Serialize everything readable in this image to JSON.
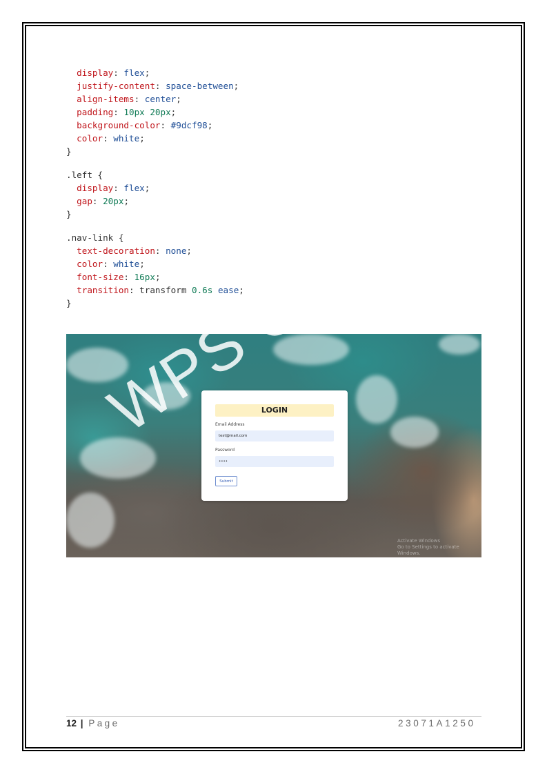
{
  "code": {
    "lines": [
      {
        "indent": "  ",
        "prop": "display",
        "value": "flex",
        "value_kind": "val"
      },
      {
        "indent": "  ",
        "prop": "justify-content",
        "value": "space-between",
        "value_kind": "val"
      },
      {
        "indent": "  ",
        "prop": "align-items",
        "value": "center",
        "value_kind": "val"
      },
      {
        "indent": "  ",
        "prop": "padding",
        "value": "10px 20px",
        "value_kind": "num"
      },
      {
        "indent": "  ",
        "prop": "background-color",
        "value": "#9dcf98",
        "value_kind": "val"
      },
      {
        "indent": "  ",
        "prop": "color",
        "value": "white",
        "value_kind": "val"
      }
    ],
    "close1": "}",
    "left_selector": ".left {",
    "left_lines": [
      {
        "prop": "display",
        "value": "flex",
        "value_kind": "val"
      },
      {
        "prop": "gap",
        "value": "20px",
        "value_kind": "num"
      }
    ],
    "close2": "}",
    "nav_selector": ".nav-link {",
    "nav_lines": [
      {
        "prop": "text-decoration",
        "value": "none",
        "value_kind": "val"
      },
      {
        "prop": "color",
        "value": "white",
        "value_kind": "val"
      },
      {
        "prop": "font-size",
        "value": "16px",
        "value_kind": "num"
      }
    ],
    "nav_transition": {
      "prop": "transition",
      "value_a": "transform",
      "value_b": "0.6s",
      "value_c": "ease"
    },
    "close3": "}"
  },
  "screenshot": {
    "login_title": "LOGIN",
    "email_label": "Email Address",
    "email_value": "test@mail.com",
    "password_label": "Password",
    "password_value": "••••",
    "submit_label": "Submit",
    "activate_line1": "Activate Windows",
    "activate_line2": "Go to Settings to activate Windows."
  },
  "watermark": "WPS Office",
  "footer": {
    "page_number": "12",
    "separator": "|",
    "page_label": "Page",
    "roll_number": "23071A1250"
  }
}
